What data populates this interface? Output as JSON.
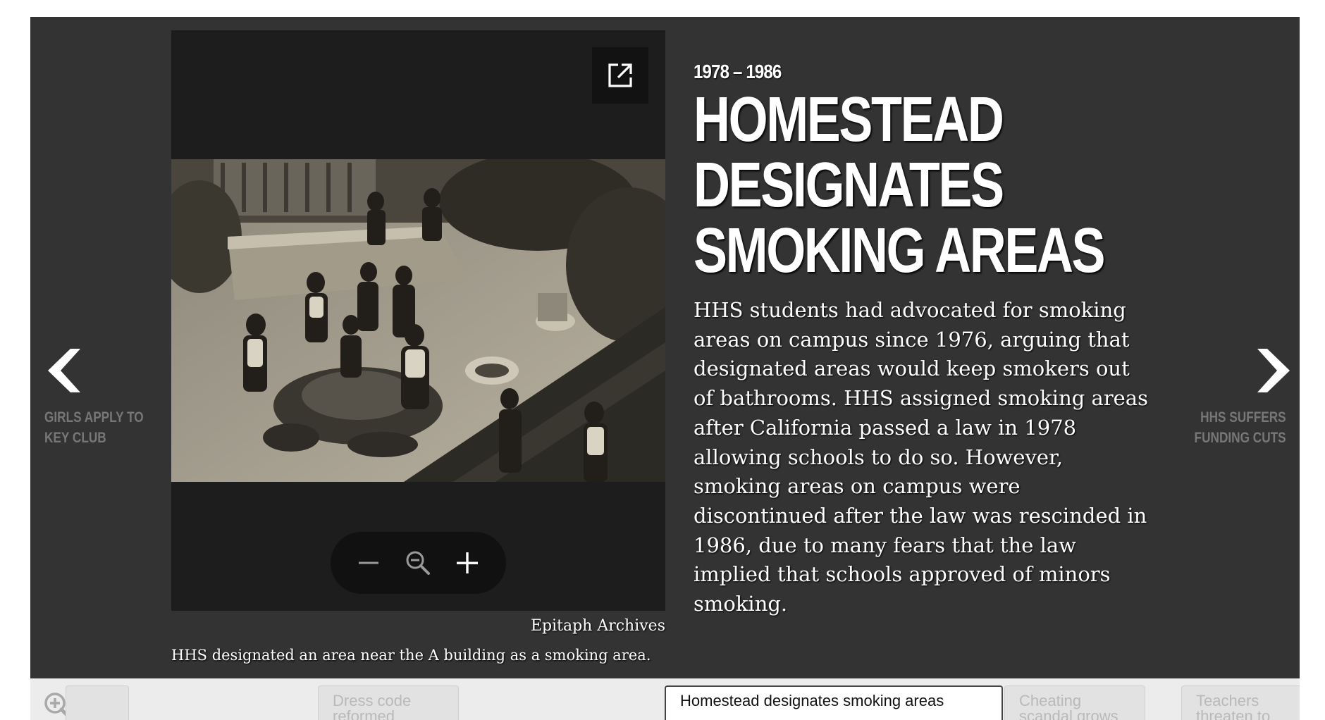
{
  "slide": {
    "date_range": "1978 – 1986",
    "headline_lines": [
      "HOMESTEAD",
      "DESIGNATES",
      "SMOKING AREAS"
    ],
    "body_lines": [
      "HHS students had advocated for smoking",
      "areas on campus since 1976, arguing that",
      "designated areas would keep smokers out",
      "of bathrooms. HHS assigned smoking areas",
      "after California passed a law in 1978",
      "allowing schools to do so. However,",
      "smoking areas on campus were",
      "discontinued after the law was rescinded in",
      "1986, due to many fears that the law",
      "implied that schools approved of minors",
      "smoking."
    ]
  },
  "media": {
    "credit": "Epitaph Archives",
    "caption": "HHS designated an area near the A building as a smoking area.",
    "open_icon": "open-in-new-icon",
    "zoom_controls": {
      "zoom_out_icon": "minus-icon",
      "zoom_reset_icon": "magnifier-icon",
      "zoom_in_icon": "plus-icon"
    }
  },
  "navigation": {
    "previous": {
      "icon": "chevron-left-icon",
      "label_lines": [
        "GIRLS APPLY TO",
        "KEY CLUB"
      ]
    },
    "next": {
      "icon": "chevron-right-icon",
      "label_lines": [
        "HHS SUFFERS",
        "FUNDING CUTS"
      ]
    }
  },
  "timeline": {
    "zoom_icon": "zoom-in-icon",
    "tabs": [
      {
        "label": "",
        "active": false
      },
      {
        "label": "Dress code reformed",
        "active": false
      },
      {
        "label": "Homestead designates smoking areas",
        "active": true
      },
      {
        "label": "Cheating scandal grows",
        "active": false
      },
      {
        "label": "Teachers threaten to",
        "active": false
      }
    ]
  },
  "colors": {
    "stage_background": "#333333",
    "media_background": "#1d1d1d",
    "timeline_background": "#ececec",
    "text": "#ffffff",
    "nav_label": "#777777"
  }
}
